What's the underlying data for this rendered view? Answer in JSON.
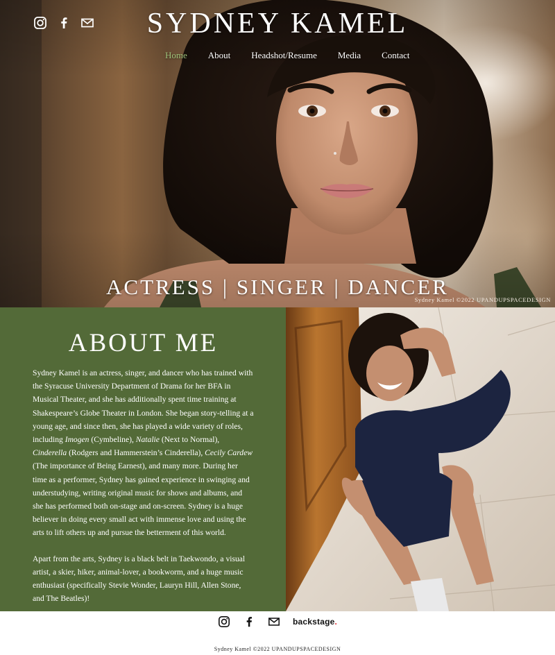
{
  "site": {
    "title": "SYDNEY KAMEL",
    "tagline": "ACTRESS | SINGER | DANCER",
    "hero_credit": "Sydney Kamel ©2022 UPANDUPSPACEDESIGN"
  },
  "nav": {
    "items": [
      {
        "label": "Home",
        "active": true
      },
      {
        "label": "About",
        "active": false
      },
      {
        "label": "Headshot/Resume",
        "active": false
      },
      {
        "label": "Media",
        "active": false
      },
      {
        "label": "Contact",
        "active": false
      }
    ]
  },
  "social": {
    "icons": [
      "instagram-icon",
      "facebook-icon",
      "mail-icon"
    ]
  },
  "about": {
    "heading": "ABOUT ME",
    "p1_seg1": "Sydney Kamel is an actress, singer, and dancer who has trained with the Syracuse University Department of Drama for her BFA in Musical Theater, and she has additionally spent time training at Shakespeare’s Globe Theater in London. She began story-telling at a young age, and since then, she has played a wide variety of roles, including ",
    "p1_role1": "Imogen",
    "p1_seg2": " (Cymbeline), ",
    "p1_role2": "Natalie",
    "p1_seg3": " (Next to Normal), ",
    "p1_role3": "Cinderella",
    "p1_seg4": " (Rodgers and Hammerstein’s Cinderella), ",
    "p1_role4": "Cecily Cardew",
    "p1_seg5": " (The importance of Being Earnest), and many more. During her time as a performer, Sydney has gained experience in swinging and understudying, writing original music for shows and albums, and she has performed both on-stage and on-screen. Sydney is a huge believer in doing every small act with immense love and using the arts to lift others up and pursue the betterment of this world.",
    "p2": "Apart from the arts, Sydney is a black belt in Taekwondo, a visual artist, a skier, hiker, animal-lover, a bookworm, and a huge music enthusiast (specifically Stevie Wonder, Lauryn Hill, Allen Stone, and The Beatles)!"
  },
  "footer": {
    "backstage_label": "backstage",
    "backstage_dot": ".",
    "copyright": "Sydney Kamel ©2022 UPANDUPSPACEDESIGN"
  },
  "colors": {
    "about_bg": "#536a38",
    "nav_active": "#9fc27a",
    "backstage_dot": "#e0262a"
  }
}
